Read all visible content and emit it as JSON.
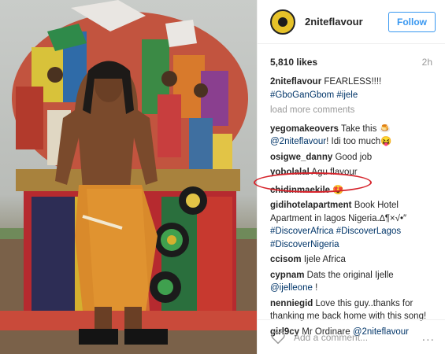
{
  "post": {
    "username": "2niteflavour",
    "follow_label": "Follow",
    "likes": "5,810 likes",
    "time": "2h",
    "caption": {
      "user": "2niteflavour",
      "text": " FEARLESS!!!!",
      "tags": "#GboGanGbom #ijele"
    },
    "load_more": "load more comments"
  },
  "comments": [
    {
      "user": "yegomakeovers",
      "text": " Take this ",
      "emoji1": "🍮",
      "mention": "@2niteflavour",
      "text2": "! Idi too much",
      "emoji2": "😝"
    },
    {
      "user": "osigwe_danny",
      "text": " Good job"
    },
    {
      "user": "yobolalal",
      "text": " Agu flavour"
    },
    {
      "user": "chidinmaekile",
      "emoji": "😍"
    },
    {
      "user": "gidihotelapartment",
      "text": " Book Hotel Apartment in lagos Nigeria.∆¶×√•″",
      "tags": "#DiscoverAfrica #DiscoverLagos #DiscoverNigeria"
    },
    {
      "user": "ccisom",
      "text": " Ijele Africa"
    },
    {
      "user": "cypnam",
      "text": " Dats the original Ijelle ",
      "mention": "@ijelleone",
      "text2": " !"
    },
    {
      "user": "nenniegid",
      "text": " Love this guy..thanks for thanking me back home with this song!"
    },
    {
      "user": "girl9cy",
      "text": " Mr Ordinare ",
      "mention": "@2niteflavour"
    }
  ],
  "footer": {
    "placeholder": "Add a comment...",
    "more": "..."
  },
  "icons": {
    "heart": "heart-outline-icon",
    "more": "more-dots-icon"
  },
  "colors": {
    "accent": "#3897f0",
    "link": "#003569",
    "highlight": "#d6232b"
  }
}
